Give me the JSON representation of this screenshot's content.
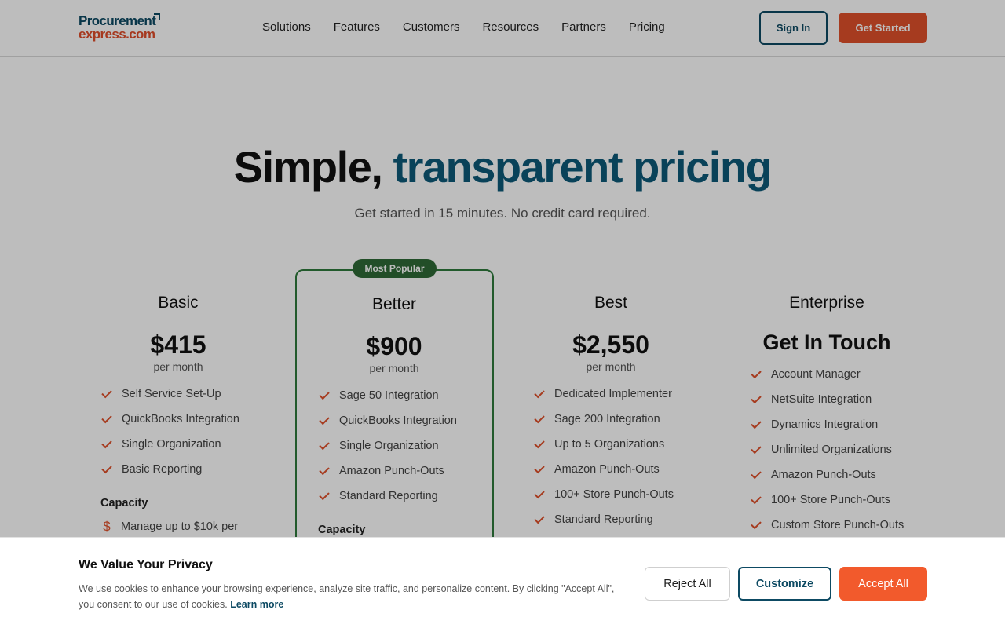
{
  "header": {
    "logo_line1": "Procurement",
    "logo_line2": "express.com",
    "nav": [
      "Solutions",
      "Features",
      "Customers",
      "Resources",
      "Partners",
      "Pricing"
    ],
    "signin_label": "Sign In",
    "get_started_label": "Get Started"
  },
  "hero": {
    "title_plain": "Simple,",
    "title_accent": "transparent pricing",
    "subtitle": "Get started in 15 minutes. No credit card required."
  },
  "plans": [
    {
      "name": "Basic",
      "price": "$415",
      "period": "per month",
      "features": [
        "Self Service Set-Up",
        "QuickBooks Integration",
        "Single Organization",
        "Basic Reporting"
      ],
      "capacity_title": "Capacity",
      "capacity_items": [
        "Manage up to $10k per"
      ]
    },
    {
      "name": "Better",
      "badge": "Most Popular",
      "price": "$900",
      "period": "per month",
      "features": [
        "Sage 50 Integration",
        "QuickBooks Integration",
        "Single Organization",
        "Amazon Punch-Outs",
        "Standard Reporting"
      ],
      "capacity_title": "Capacity"
    },
    {
      "name": "Best",
      "price": "$2,550",
      "period": "per month",
      "features": [
        "Dedicated Implementer",
        "Sage 200 Integration",
        "Up to 5 Organizations",
        "Amazon Punch-Outs",
        "100+ Store Punch-Outs",
        "Standard Reporting"
      ]
    },
    {
      "name": "Enterprise",
      "price": "Get In Touch",
      "features": [
        "Account Manager",
        "NetSuite Integration",
        "Dynamics Integration",
        "Unlimited Organizations",
        "Amazon Punch-Outs",
        "100+ Store Punch-Outs",
        "Custom Store Punch-Outs"
      ]
    }
  ],
  "cookie": {
    "title": "We Value Your Privacy",
    "text": "We use cookies to enhance your browsing experience, analyze site traffic, and personalize content. By clicking \"Accept All\", you consent to our use of cookies.",
    "learn_more": "Learn more",
    "reject_label": "Reject All",
    "customize_label": "Customize",
    "accept_label": "Accept All"
  },
  "colors": {
    "brand_navy": "#0d4a63",
    "brand_orange": "#e0502a",
    "popular_green": "#2e7a3c",
    "accept_orange": "#f25a2c"
  },
  "icons": {
    "feature_check": "check-icon",
    "capacity_item": "dollar-icon"
  }
}
